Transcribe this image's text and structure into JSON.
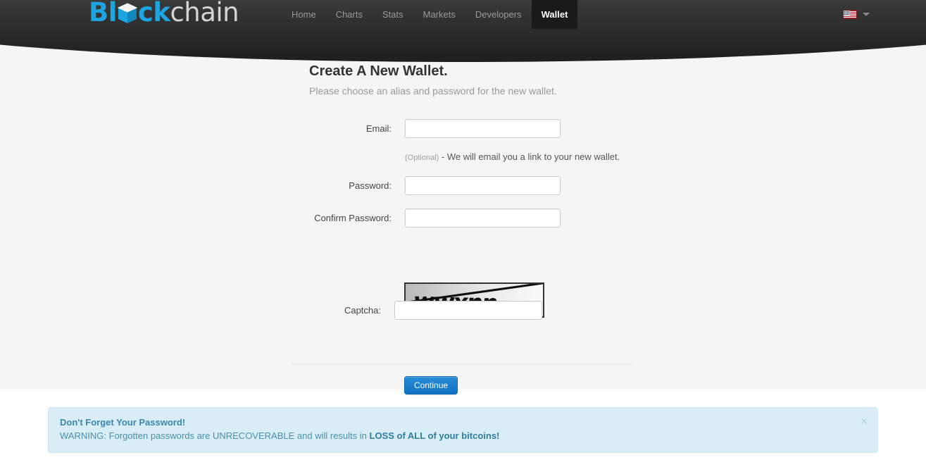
{
  "header": {
    "logo": {
      "prefix": "Bl",
      "cube_icon": "cube-icon",
      "mid": "ck",
      "suffix": "chain"
    },
    "nav": [
      {
        "label": "Home",
        "name": "nav-item-home",
        "active": false
      },
      {
        "label": "Charts",
        "name": "nav-item-charts",
        "active": false
      },
      {
        "label": "Stats",
        "name": "nav-item-stats",
        "active": false
      },
      {
        "label": "Markets",
        "name": "nav-item-markets",
        "active": false
      },
      {
        "label": "Developers",
        "name": "nav-item-developers",
        "active": false
      },
      {
        "label": "Wallet",
        "name": "nav-item-wallet",
        "active": true
      }
    ],
    "language": {
      "flag": "us-flag-icon",
      "caret": "chevron-down-icon"
    }
  },
  "main": {
    "title": "Create A New Wallet.",
    "subtitle": "Please choose an alias and password for the new wallet.",
    "fields": {
      "email": {
        "label": "Email:",
        "value": "",
        "placeholder": ""
      },
      "password": {
        "label": "Password:",
        "value": "",
        "placeholder": ""
      },
      "confirm": {
        "label": "Confirm Password:",
        "value": "",
        "placeholder": ""
      },
      "captcha": {
        "label": "Captcha:",
        "value": "",
        "placeholder": ""
      }
    },
    "email_help": {
      "optional": "(Optional)",
      "text": " - We will email you a link to your new wallet."
    },
    "captcha_image": {
      "text": "wwxnn",
      "alt": "captcha-image"
    },
    "continue_label": "Continue"
  },
  "alert": {
    "heading": "Don't Forget Your Password!",
    "body_prefix": "WARNING: Forgotten passwords are UNRECOVERABLE and will results in ",
    "body_strong": "LOSS of ALL of your bitcoins!",
    "close_label": "×",
    "bg_color": "#d9edf7",
    "text_color": "#3a87ad"
  },
  "colors": {
    "header_bg": "#2b2b2b",
    "logo_blue": "#1ca5e0",
    "content_bg": "#f5f5f5",
    "button_blue": "#0f72c4"
  }
}
